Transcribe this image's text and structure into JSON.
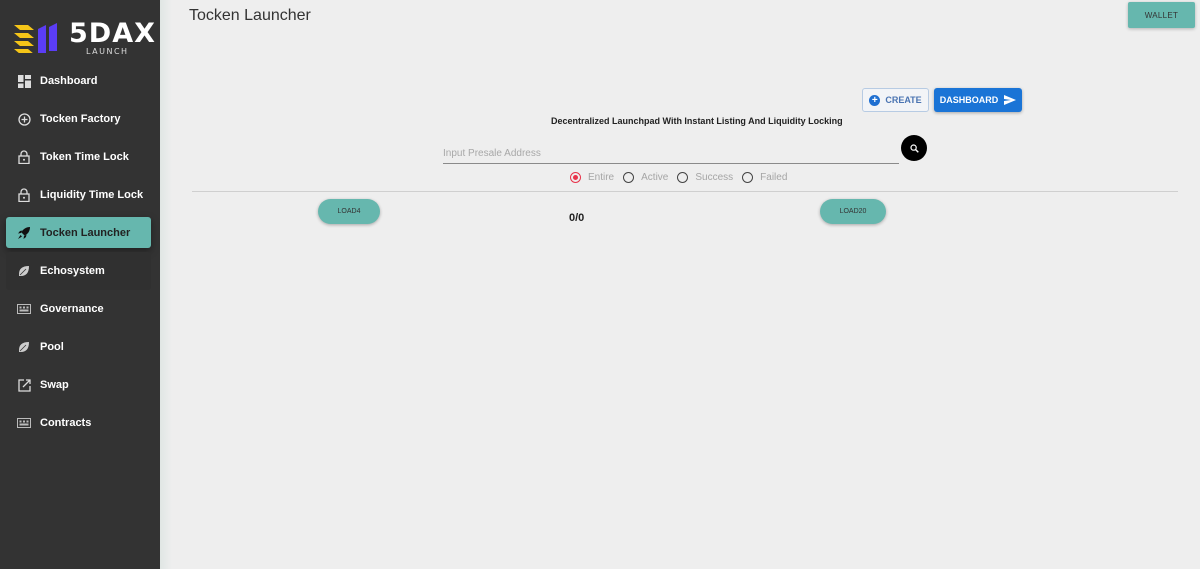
{
  "brand": {
    "name": "5DAX",
    "subtitle": "LAUNCH",
    "colors": {
      "stripes": "#f5c518",
      "bars": "#5b3df5"
    }
  },
  "sidebar": {
    "items": [
      {
        "label": "Dashboard",
        "icon": "dashboard-icon",
        "active": false
      },
      {
        "label": "Tocken Factory",
        "icon": "add-circle-icon",
        "active": false
      },
      {
        "label": "Token Time Lock",
        "icon": "lock-icon",
        "active": false
      },
      {
        "label": "Liquidity Time Lock",
        "icon": "lock-icon",
        "active": false
      },
      {
        "label": "Tocken Launcher",
        "icon": "rocket-icon",
        "active": true
      },
      {
        "label": "Echosystem",
        "icon": "leaf-icon",
        "active": false
      },
      {
        "label": "Governance",
        "icon": "keyboard-icon",
        "active": false
      },
      {
        "label": "Pool",
        "icon": "leaf-icon",
        "active": false
      },
      {
        "label": "Swap",
        "icon": "open-external-icon",
        "active": false
      },
      {
        "label": "Contracts",
        "icon": "keyboard-icon",
        "active": false
      }
    ],
    "active_color": "#66b7ae"
  },
  "header": {
    "title": "Tocken Launcher",
    "wallet_label": "WALLET"
  },
  "actions": {
    "create_label": "CREATE",
    "dashboard_label": "DASHBOARD"
  },
  "tagline": "Decentralized Launchpad With Instant Listing And Liquidity Locking",
  "search": {
    "value": "",
    "placeholder": "Input Presale Address"
  },
  "filters": {
    "options": [
      "Entire",
      "Active",
      "Success",
      "Failed"
    ],
    "selected": "Entire"
  },
  "pagination": {
    "load_small_label": "LOAD4",
    "load_large_label": "LOAD20",
    "counter": "0/0"
  }
}
